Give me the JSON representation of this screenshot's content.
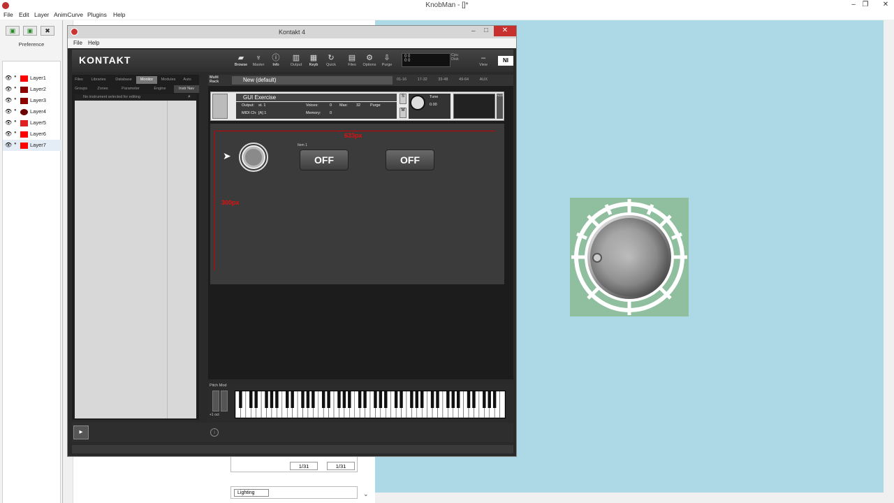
{
  "knobman": {
    "title": "KnobMan - []*",
    "menu": [
      "File",
      "Edit",
      "Layer",
      "AnimCurve",
      "Plugins",
      "Help"
    ],
    "layers_header": "Preference",
    "layers": [
      {
        "label": "Layer1",
        "color": "#ff0000"
      },
      {
        "label": "Layer2",
        "color": "#8b0000"
      },
      {
        "label": "Layer3",
        "color": "#8b0000"
      },
      {
        "label": "Layer4",
        "color": "#6b0000"
      },
      {
        "label": "Layer5",
        "color": "#e02020"
      },
      {
        "label": "Layer6",
        "color": "#ff0000"
      },
      {
        "label": "Layer7",
        "color": "#ff0000"
      }
    ],
    "frame_a": "1/31",
    "frame_b": "1/31",
    "lighting_tab": "Lighting",
    "canvas_bg": "#add8e6",
    "knob_bg": "#8fbf9f"
  },
  "kontakt": {
    "title": "Kontakt 4",
    "menu": [
      "File",
      "Help"
    ],
    "logo": "KONTAKT",
    "toolbar": [
      "Browse",
      "Master",
      "Info",
      "Output",
      "Keyb",
      "Quick",
      "Files",
      "Options",
      "Purge",
      "View"
    ],
    "meter_top": "0 0",
    "meter_bottom": "0 0",
    "cpu": "Cpu",
    "disk": "Disk",
    "browser_tabs_row1": [
      "Files",
      "Libraries",
      "Database",
      "Monitor",
      "Modules",
      "Auto"
    ],
    "browser_tabs_row2": [
      "Groups",
      "Zones",
      "Parameter",
      "Engine",
      "Instr Nav"
    ],
    "browser_header": "No instrument selected for editing",
    "rack_label_a": "Multi",
    "rack_label_b": "Rack",
    "multi_name": "New (default)",
    "rack_pages": [
      "01-16",
      "17-32",
      "33-48",
      "49-64",
      "AUX"
    ],
    "instrument": {
      "name": "GUI Exercise",
      "output_label": "Output:",
      "output_value": "st. 1",
      "voices_label": "Voices:",
      "voices_value": "0",
      "max_label": "Max:",
      "max_value": "32",
      "purge": "Purge",
      "midi_label": "MIDI Ch:",
      "midi_value": "[A] 1",
      "memory_label": "Memory:",
      "memory_value": "0",
      "tune_label": "Tune",
      "tune_value": "0.00",
      "s": "S",
      "m": "M",
      "pan": "AUX"
    },
    "panel": {
      "width_label": "633px",
      "height_label": "300px",
      "item_label": "Item 1",
      "button1": "OFF",
      "button2": "OFF"
    },
    "keyboard_label": "Pitch Mod",
    "octave_label": "+1 oct"
  }
}
